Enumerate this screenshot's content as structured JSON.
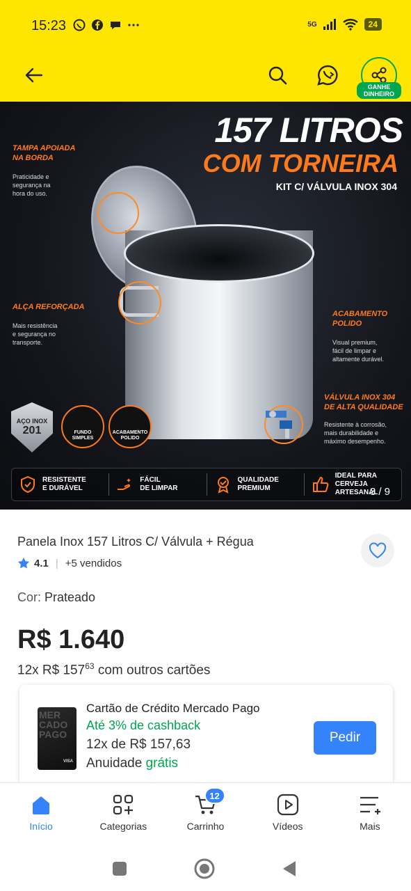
{
  "status_bar": {
    "time": "15:23",
    "network": "5G",
    "battery": "24",
    "left_icons": [
      "whatsapp-icon",
      "facebook-icon",
      "chat-icon",
      "more-icon"
    ]
  },
  "header": {
    "share_badge": "GANHE\nDINHEIRO",
    "brand_color": "#ffe600"
  },
  "hero": {
    "title_line1": "157 LITROS",
    "title_line2": "COM TORNEIRA",
    "title_line3": "KIT C/ VÁLVULA INOX 304",
    "callouts": {
      "lid_title": "TAMPA APOIADA\nNA BORDA",
      "lid_text": "Praticidade e\nsegurança na\nhora do uso.",
      "handle_title": "ALÇA REFORÇADA",
      "handle_text": "Mais resistência\ne segurança no\ntransporte.",
      "finish_title": "ACABAMENTO\nPOLIDO",
      "finish_text": "Visual premium,\nfácil de limpar e\naltamente durável.",
      "valve_title": "VÁLVULA INOX 304\nDE ALTA QUALIDADE",
      "valve_text": "Resistente à corrosão,\nmais durabilidade e\nmáximo desempenho."
    },
    "shield_top": "AÇO INOX",
    "shield_num": "201",
    "badge1": "FUNDO\nSIMPLES",
    "badge2": "ACABAMENTO\nPOLIDO",
    "features": [
      {
        "label": "RESISTENTE\nE DURÁVEL"
      },
      {
        "label": "FÁCIL\nDE LIMPAR"
      },
      {
        "label": "QUALIDADE\nPREMIUM"
      },
      {
        "label": "IDEAL PARA\nCERVEJA ARTESANAL"
      }
    ],
    "counter": "3 / 9"
  },
  "product": {
    "title": "Panela Inox 157 Litros C/ Válvula + Régua",
    "rating": "4.1",
    "sold": "+5 vendidos",
    "color_label": "Cor: ",
    "color_value": "Prateado",
    "price": "R$ 1.640",
    "installments_prefix": "12x R$ 157",
    "installments_cents": "63",
    "installments_suffix": " com outros cartões"
  },
  "promo": {
    "card_text": "MER\nCADO\nPAGO",
    "card_brand": "VISA",
    "title": "Cartão de Crédito Mercado Pago",
    "cashback": "Até 3% de cashback",
    "installments": "12x de R$ 157,63",
    "annuity_prefix": "Anuidade ",
    "annuity_value": "grátis",
    "button": "Pedir"
  },
  "bottom_nav": {
    "items": [
      {
        "label": "Início",
        "icon": "home-icon"
      },
      {
        "label": "Categorias",
        "icon": "categories-icon"
      },
      {
        "label": "Carrinho",
        "icon": "cart-icon"
      },
      {
        "label": "Vídeos",
        "icon": "play-icon"
      },
      {
        "label": "Mais",
        "icon": "menu-icon"
      }
    ],
    "cart_count": "12",
    "active_color": "#3483fa"
  }
}
